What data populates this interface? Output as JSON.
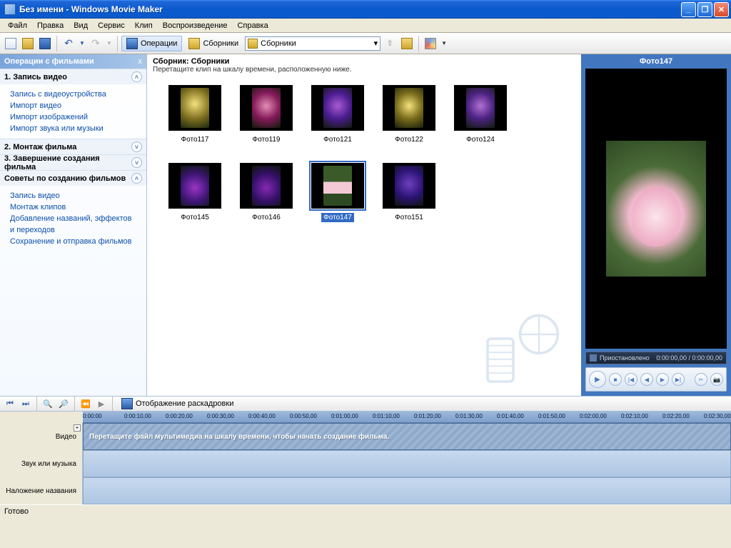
{
  "window": {
    "title": "Без имени - Windows Movie Maker"
  },
  "menu": [
    "Файл",
    "Правка",
    "Вид",
    "Сервис",
    "Клип",
    "Воспроизведение",
    "Справка"
  ],
  "toolbar": {
    "tasks": "Операции",
    "collections": "Сборники",
    "combo_value": "Сборники"
  },
  "sidebar": {
    "header": "Операции с фильмами",
    "sections": [
      {
        "title": "1. Запись видео",
        "expanded": true,
        "links": [
          "Запись с видеоустройства",
          "Импорт видео",
          "Импорт изображений",
          "Импорт звука или музыки"
        ]
      },
      {
        "title": "2. Монтаж фильма",
        "expanded": false,
        "links": []
      },
      {
        "title": "3. Завершение создания фильма",
        "expanded": false,
        "links": []
      },
      {
        "title": "Советы по созданию фильмов",
        "expanded": true,
        "links": [
          "Запись видео",
          "Монтаж клипов",
          "Добавление названий, эффектов и переходов",
          "Сохранение и отправка фильмов"
        ]
      }
    ]
  },
  "collection": {
    "title": "Сборник: Сборники",
    "subtitle": "Перетащите клип на шкалу времени, расположенную ниже.",
    "items": [
      {
        "label": "Фото117",
        "cls": "f1",
        "selected": false
      },
      {
        "label": "Фото119",
        "cls": "f2",
        "selected": false
      },
      {
        "label": "Фото121",
        "cls": "f3",
        "selected": false
      },
      {
        "label": "Фото122",
        "cls": "f4",
        "selected": false
      },
      {
        "label": "Фото124",
        "cls": "f5",
        "selected": false
      },
      {
        "label": "Фото145",
        "cls": "f7",
        "selected": false
      },
      {
        "label": "Фото146",
        "cls": "f8",
        "selected": false
      },
      {
        "label": "Фото147",
        "cls": "f9",
        "selected": true
      },
      {
        "label": "Фото151",
        "cls": "f10",
        "selected": false
      }
    ]
  },
  "preview": {
    "title": "Фото147",
    "status": "Приостановлено",
    "time": "0:00:00,00 / 0:00:00,00"
  },
  "timeline": {
    "toggle_label": "Отображение раскадровки",
    "ruler": [
      "0:00:00",
      "0:00:10,00",
      "0:00:20,00",
      "0:00:30,00",
      "0:00:40,00",
      "0:00:50,00",
      "0:01:00,00",
      "0:01:10,00",
      "0:01:20,00",
      "0:01:30,00",
      "0:01:40,00",
      "0:01:50,00",
      "0:02:00,00",
      "0:02:10,00",
      "0:02:20,00",
      "0:02:30,00"
    ],
    "tracks": {
      "video": "Видео",
      "audio": "Звук или музыка",
      "title": "Наложение названия"
    },
    "drop_hint": "Перетащите файл мультимедиа на шкалу времени, чтобы начать создание фильма."
  },
  "status": "Готово"
}
